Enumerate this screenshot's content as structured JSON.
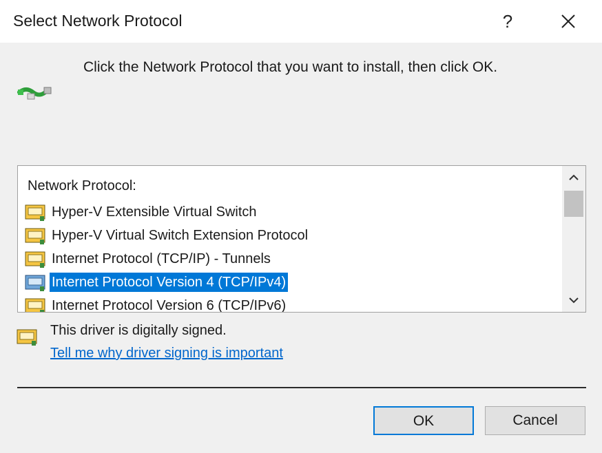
{
  "window": {
    "title": "Select Network Protocol",
    "help_label": "?",
    "close_icon": "close-icon"
  },
  "instruction": "Click the Network Protocol that you want to install, then click OK.",
  "header_icon": "network-cable-icon",
  "list": {
    "header": "Network Protocol:",
    "items": [
      {
        "label": "Hyper-V Extensible Virtual Switch",
        "selected": false
      },
      {
        "label": "Hyper-V Virtual Switch Extension Protocol",
        "selected": false
      },
      {
        "label": "Internet Protocol (TCP/IP) - Tunnels",
        "selected": false
      },
      {
        "label": "Internet Protocol Version 4 (TCP/IPv4)",
        "selected": true
      },
      {
        "label": "Internet Protocol Version 6 (TCP/IPv6)",
        "selected": false
      }
    ],
    "scroll_up_icon": "chevron-up-icon",
    "scroll_down_icon": "chevron-down-icon"
  },
  "signature": {
    "text": "This driver is digitally signed.",
    "link": "Tell me why driver signing is important"
  },
  "buttons": {
    "ok": "OK",
    "cancel": "Cancel"
  },
  "colors": {
    "selection": "#0078d7",
    "link": "#0066cc",
    "dialog_bg": "#f0f0f0"
  }
}
